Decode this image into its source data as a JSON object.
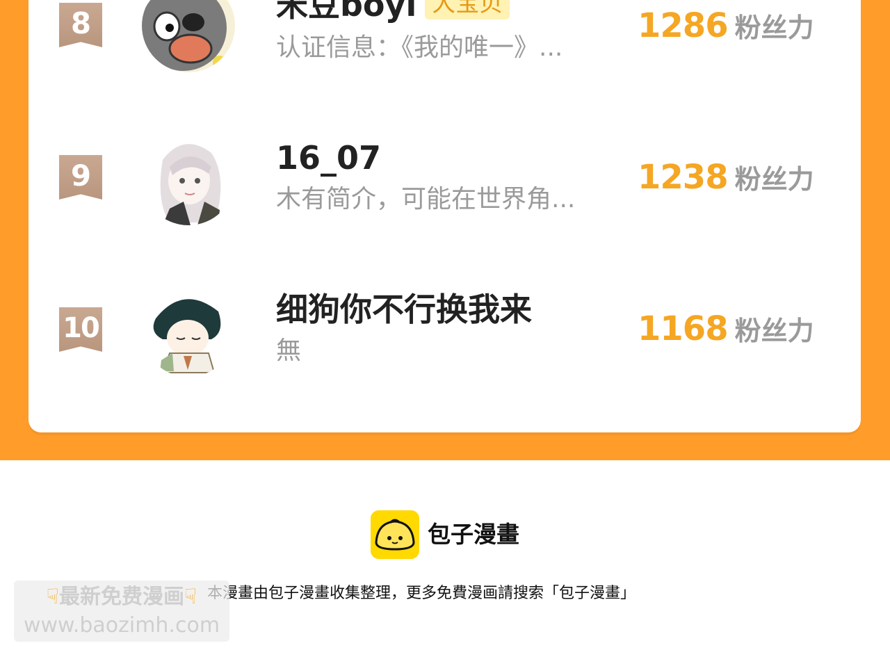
{
  "ranking": {
    "rows": [
      {
        "rank": "8",
        "name": "米豆boyi",
        "badge": "大宝贝",
        "description": "认证信息：《我的唯一》...",
        "fans_value": "1286",
        "fans_unit": "粉丝力",
        "avatar_icon": "gray-cartoon-animal-avatar"
      },
      {
        "rank": "9",
        "name": "16_07",
        "badge": "",
        "description": "木有简介，可能在世界角...",
        "fans_value": "1238",
        "fans_unit": "粉丝力",
        "avatar_icon": "anime-girl-avatar"
      },
      {
        "rank": "10",
        "name": "细狗你不行换我来",
        "badge": "",
        "description": "無",
        "fans_value": "1168",
        "fans_unit": "粉丝力",
        "avatar_icon": "chibi-boy-avatar"
      }
    ]
  },
  "footer": {
    "brand": "包子漫畫",
    "note": "本漫畫由包子漫畫收集整理，更多免費漫画請搜索「包子漫畫」",
    "logo_icon": "bun-logo-icon"
  },
  "watermark": {
    "line1": "最新免费漫画",
    "line2": "www.baozimh.com",
    "hand_icon": "pointing-down-hand-icon"
  },
  "colors": {
    "band": "#ff9c2a",
    "fans_number": "#f5a623",
    "badge_bg": "#fff2b3",
    "rank_ribbon": "#c0a08a",
    "logo_yellow": "#ffd900"
  }
}
